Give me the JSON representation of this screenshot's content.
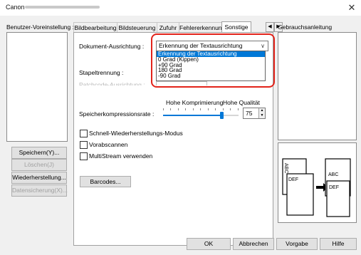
{
  "window": {
    "title": "Canon",
    "close_glyph": "✕"
  },
  "left": {
    "label_html_text": "Benutzer-Voreinstellung :",
    "buttons": [
      {
        "label": "Speichern(Y)...",
        "enabled": true
      },
      {
        "label": "Löschen(J)",
        "enabled": false
      },
      {
        "label": "Wiederherstellung...",
        "enabled": true
      },
      {
        "label": "Datensicherung(X)...",
        "enabled": false
      }
    ]
  },
  "tabs": [
    {
      "label": "Bildbearbeitung"
    },
    {
      "label": "Bildsteuerung"
    },
    {
      "label": "Zufuhr"
    },
    {
      "label": "Fehlererkennung"
    },
    {
      "label": "Sonstige"
    }
  ],
  "tab_arrows": {
    "prev": "◀",
    "next": "▶"
  },
  "sonstige": {
    "doc_orientation_label": "Dokument-Ausrichtung :",
    "doc_orientation_value": "Erkennung der Textausrichtung",
    "dropdown_options": [
      "Erkennung der Textausrichtung",
      "0 Grad (Kippen)",
      "+90 Grad",
      "180 Grad",
      "-90 Grad"
    ],
    "stapel_label": "Stapeltrennung :",
    "patchcode_label": "Patchcode-Ausrichtung :",
    "compression_label": "Speicherkompressionsrate :",
    "compression_left": "Hohe Komprimierung",
    "compression_right": "Hohe Qualität",
    "compression_value": "75",
    "slider_fraction": 0.78,
    "checks": [
      {
        "label": "Schnell-Wiederherstellungs-Modus",
        "checked": false
      },
      {
        "label": "Vorabscannen",
        "checked": false
      },
      {
        "label": "MultiStream verwenden",
        "checked": false
      }
    ],
    "barcodes_button": "Barcodes..."
  },
  "help": {
    "label": "Gebrauchsanleitung",
    "illustration": {
      "left_text": "ABC",
      "left_text2": "DEF",
      "right_text": "ABC",
      "right_text2": "DEF"
    }
  },
  "bottom_buttons": [
    {
      "label": "OK"
    },
    {
      "label": "Abbrechen"
    },
    {
      "label": "Vorgabe"
    },
    {
      "label": "Hilfe"
    }
  ]
}
